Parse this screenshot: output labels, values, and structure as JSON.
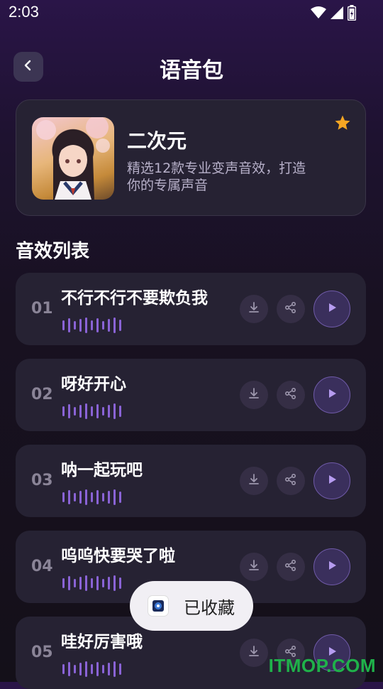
{
  "status_bar": {
    "time": "2:03"
  },
  "header": {
    "title": "语音包"
  },
  "pack": {
    "name": "二次元",
    "description": "精选12款专业变声音效，打造你的专属声音",
    "favorited": true,
    "star_color": "#f5a623"
  },
  "section": {
    "title": "音效列表"
  },
  "items": [
    {
      "number": "01",
      "title": "不行不行不要欺负我"
    },
    {
      "number": "02",
      "title": "呀好开心"
    },
    {
      "number": "03",
      "title": "呐一起玩吧"
    },
    {
      "number": "04",
      "title": "呜呜快要哭了啦"
    },
    {
      "number": "05",
      "title": "哇好厉害哦"
    }
  ],
  "toast": {
    "text": "已收藏"
  },
  "watermark": "ITMOP.COM",
  "colors": {
    "accent": "#8a63d6",
    "card": "#262233",
    "background": "#181121"
  }
}
